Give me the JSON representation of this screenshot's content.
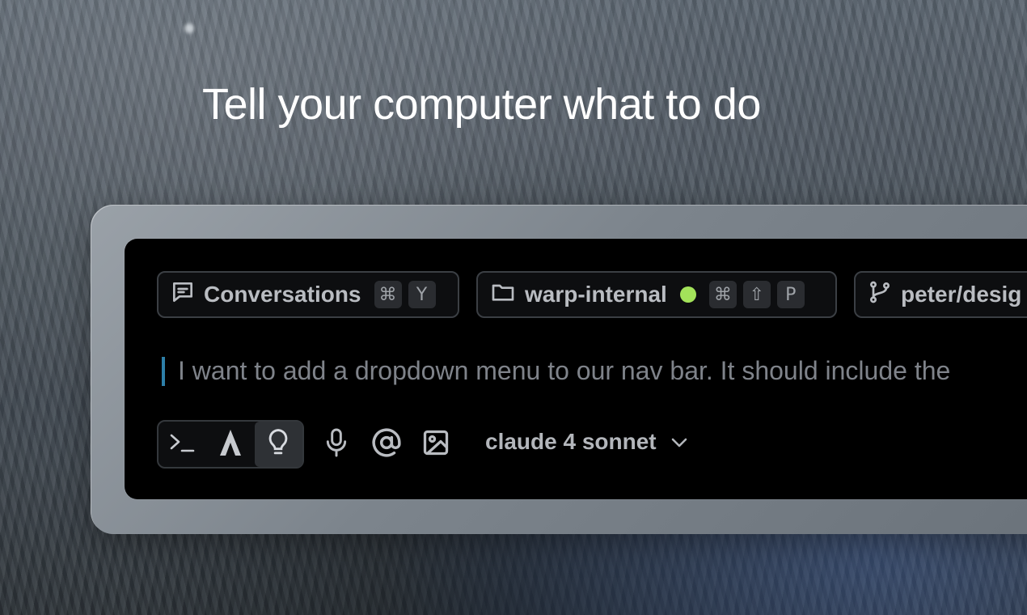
{
  "headline": "Tell your computer what to do",
  "chips": {
    "conversations": {
      "label": "Conversations",
      "icon": "chat-bubble-icon",
      "keys": [
        "⌘",
        "Y"
      ]
    },
    "folder": {
      "label": "warp-internal",
      "icon": "folder-icon",
      "status_color": "#a3e35a",
      "keys": [
        "⌘",
        "⇧",
        "P"
      ]
    },
    "branch": {
      "label": "peter/desig",
      "icon": "git-branch-icon"
    }
  },
  "prompt": {
    "text": "I want to add a dropdown menu to our nav bar. It should include the"
  },
  "modes": [
    {
      "icon": "terminal-icon",
      "active": false
    },
    {
      "icon": "agent-icon",
      "active": false
    },
    {
      "icon": "lightbulb-icon",
      "active": true
    }
  ],
  "tools": [
    "microphone-icon",
    "at-mention-icon",
    "image-icon"
  ],
  "model": {
    "label": "claude 4 sonnet",
    "icon": "chevron-down-icon"
  },
  "colors": {
    "accent_caret": "#2d7fa8",
    "status_green": "#a3e35a",
    "panel_bg": "#000000"
  }
}
